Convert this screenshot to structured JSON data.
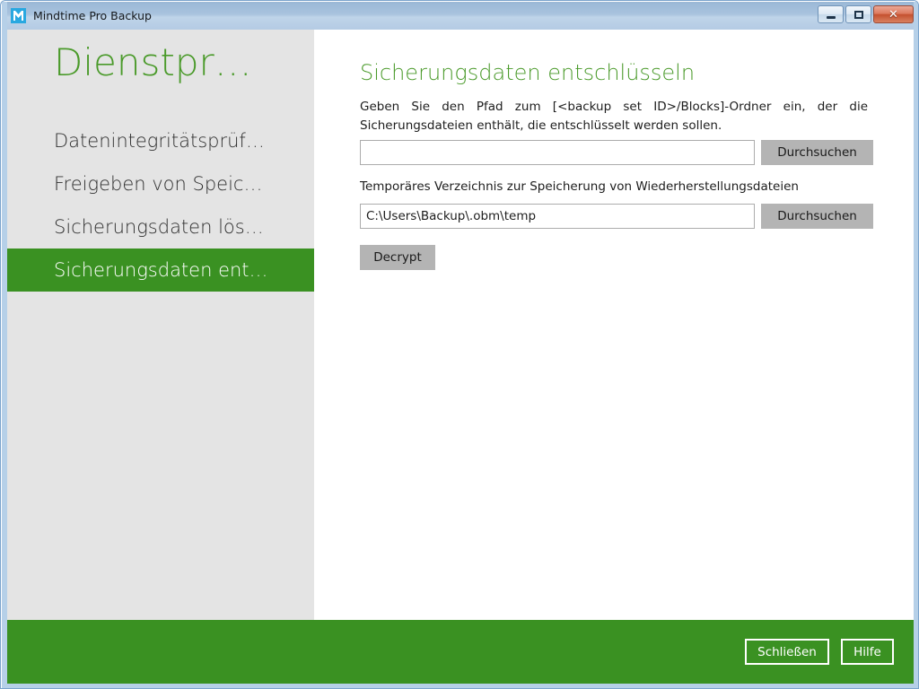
{
  "window": {
    "title": "Mindtime Pro Backup",
    "logo_icon": "mindtime-m-logo-icon",
    "controls": {
      "minimize_icon": "minimize-icon",
      "maximize_icon": "maximize-icon",
      "close_icon": "close-icon",
      "close_glyph": "✕"
    }
  },
  "sidebar": {
    "title": "Dienstpr…",
    "items": [
      {
        "label": "Datenintegritätsprüf…",
        "active": false
      },
      {
        "label": "Freigeben von Speic…",
        "active": false
      },
      {
        "label": "Sicherungsdaten lös…",
        "active": false
      },
      {
        "label": "Sicherungsdaten ent…",
        "active": true
      }
    ]
  },
  "main": {
    "heading": "Sicherungsdaten entschlüsseln",
    "description": "Geben Sie den Pfad zum [<backup set ID>/Blocks]-Ordner ein, der die Sicherungsdateien enthält, die entschlüsselt werden sollen.",
    "blocks_path": {
      "value": "",
      "placeholder": "",
      "browse_label": "Durchsuchen"
    },
    "temp_dir": {
      "label": "Temporäres Verzeichnis zur Speicherung von Wiederherstellungsdateien",
      "value": "C:\\Users\\Backup\\.obm\\temp",
      "placeholder": "",
      "browse_label": "Durchsuchen"
    },
    "decrypt_label": "Decrypt"
  },
  "footer": {
    "close_label": "Schließen",
    "help_label": "Hilfe"
  },
  "colors": {
    "brand_green": "#3a9122",
    "heading_green": "#4a9a2a",
    "sidebar_bg": "#e4e4e4",
    "button_gray": "#b4b4b4",
    "input_border": "#acacac",
    "titlebar_blue": "#a9c3de",
    "logo_blue": "#29a8e0",
    "close_red": "#c4512f"
  }
}
